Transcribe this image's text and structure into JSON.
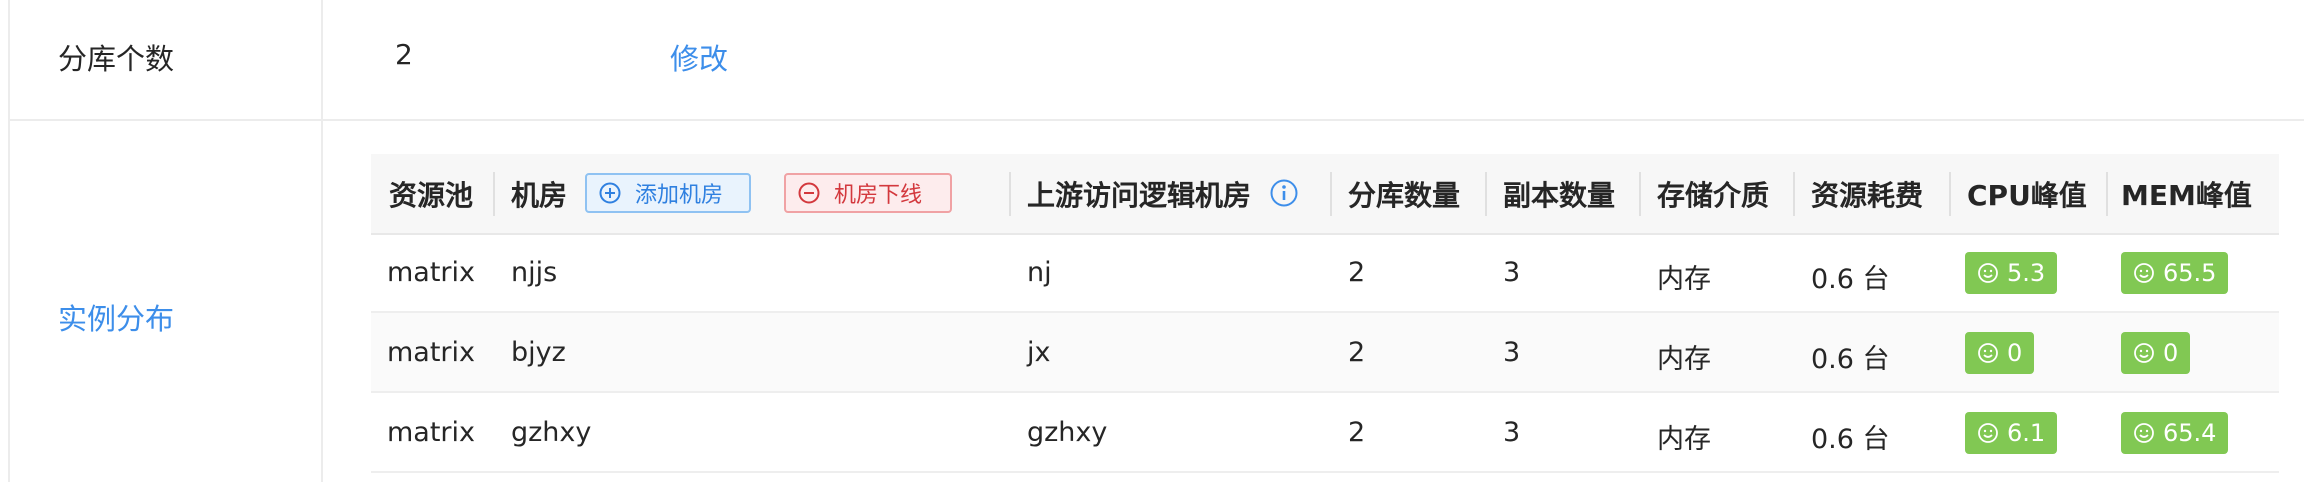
{
  "shard_count": {
    "label": "分库个数",
    "value": "2",
    "modify_label": "修改"
  },
  "instance_distribution": {
    "label": "实例分布",
    "add_room_label": "添加机房",
    "offline_room_label": "机房下线",
    "columns": [
      "资源池",
      "机房",
      "上游访问逻辑机房",
      "分库数量",
      "副本数量",
      "存储介质",
      "资源耗费",
      "CPU峰值",
      "MEM峰值"
    ],
    "rows": [
      {
        "pool": "matrix",
        "room": "njjs",
        "upstream": "nj",
        "shards": "2",
        "replicas": "3",
        "medium": "内存",
        "cost": "0.6 台",
        "cpu": "5.3",
        "mem": "65.5"
      },
      {
        "pool": "matrix",
        "room": "bjyz",
        "upstream": "jx",
        "shards": "2",
        "replicas": "3",
        "medium": "内存",
        "cost": "0.6 台",
        "cpu": "0",
        "mem": "0"
      },
      {
        "pool": "matrix",
        "room": "gzhxy",
        "upstream": "gzhxy",
        "shards": "2",
        "replicas": "3",
        "medium": "内存",
        "cost": "0.6 台",
        "cpu": "6.1",
        "mem": "65.4"
      }
    ]
  },
  "colors": {
    "link": "#3d8eea",
    "badge_ok": "#81c853",
    "add_btn": "#2f80e0",
    "offline_btn": "#d3383d"
  },
  "icons": {
    "add": "plus-circle-icon",
    "offline": "minus-circle-icon",
    "info": "info-circle-icon",
    "badge": "smile-icon"
  }
}
